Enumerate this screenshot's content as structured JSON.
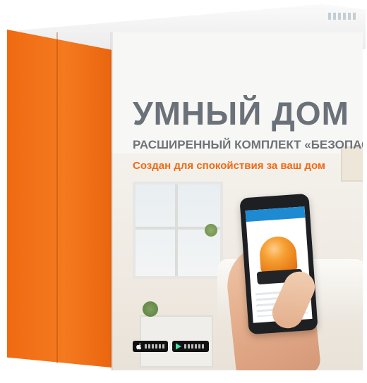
{
  "product": {
    "title": "УМНЫЙ ДОМ",
    "subtitle": "РАСШИРЕННЫЙ КОМПЛЕКТ «БЕЗОПАСНОСТ",
    "tagline": "Создан для спокойствия за ваш дом"
  },
  "colors": {
    "accent_orange": "#f06a12",
    "title_gray": "#6b7178",
    "phone_bar_blue": "#1e8ad2"
  },
  "icons": {
    "apple_store": "apple-icon",
    "google_play": "google-play-icon"
  }
}
